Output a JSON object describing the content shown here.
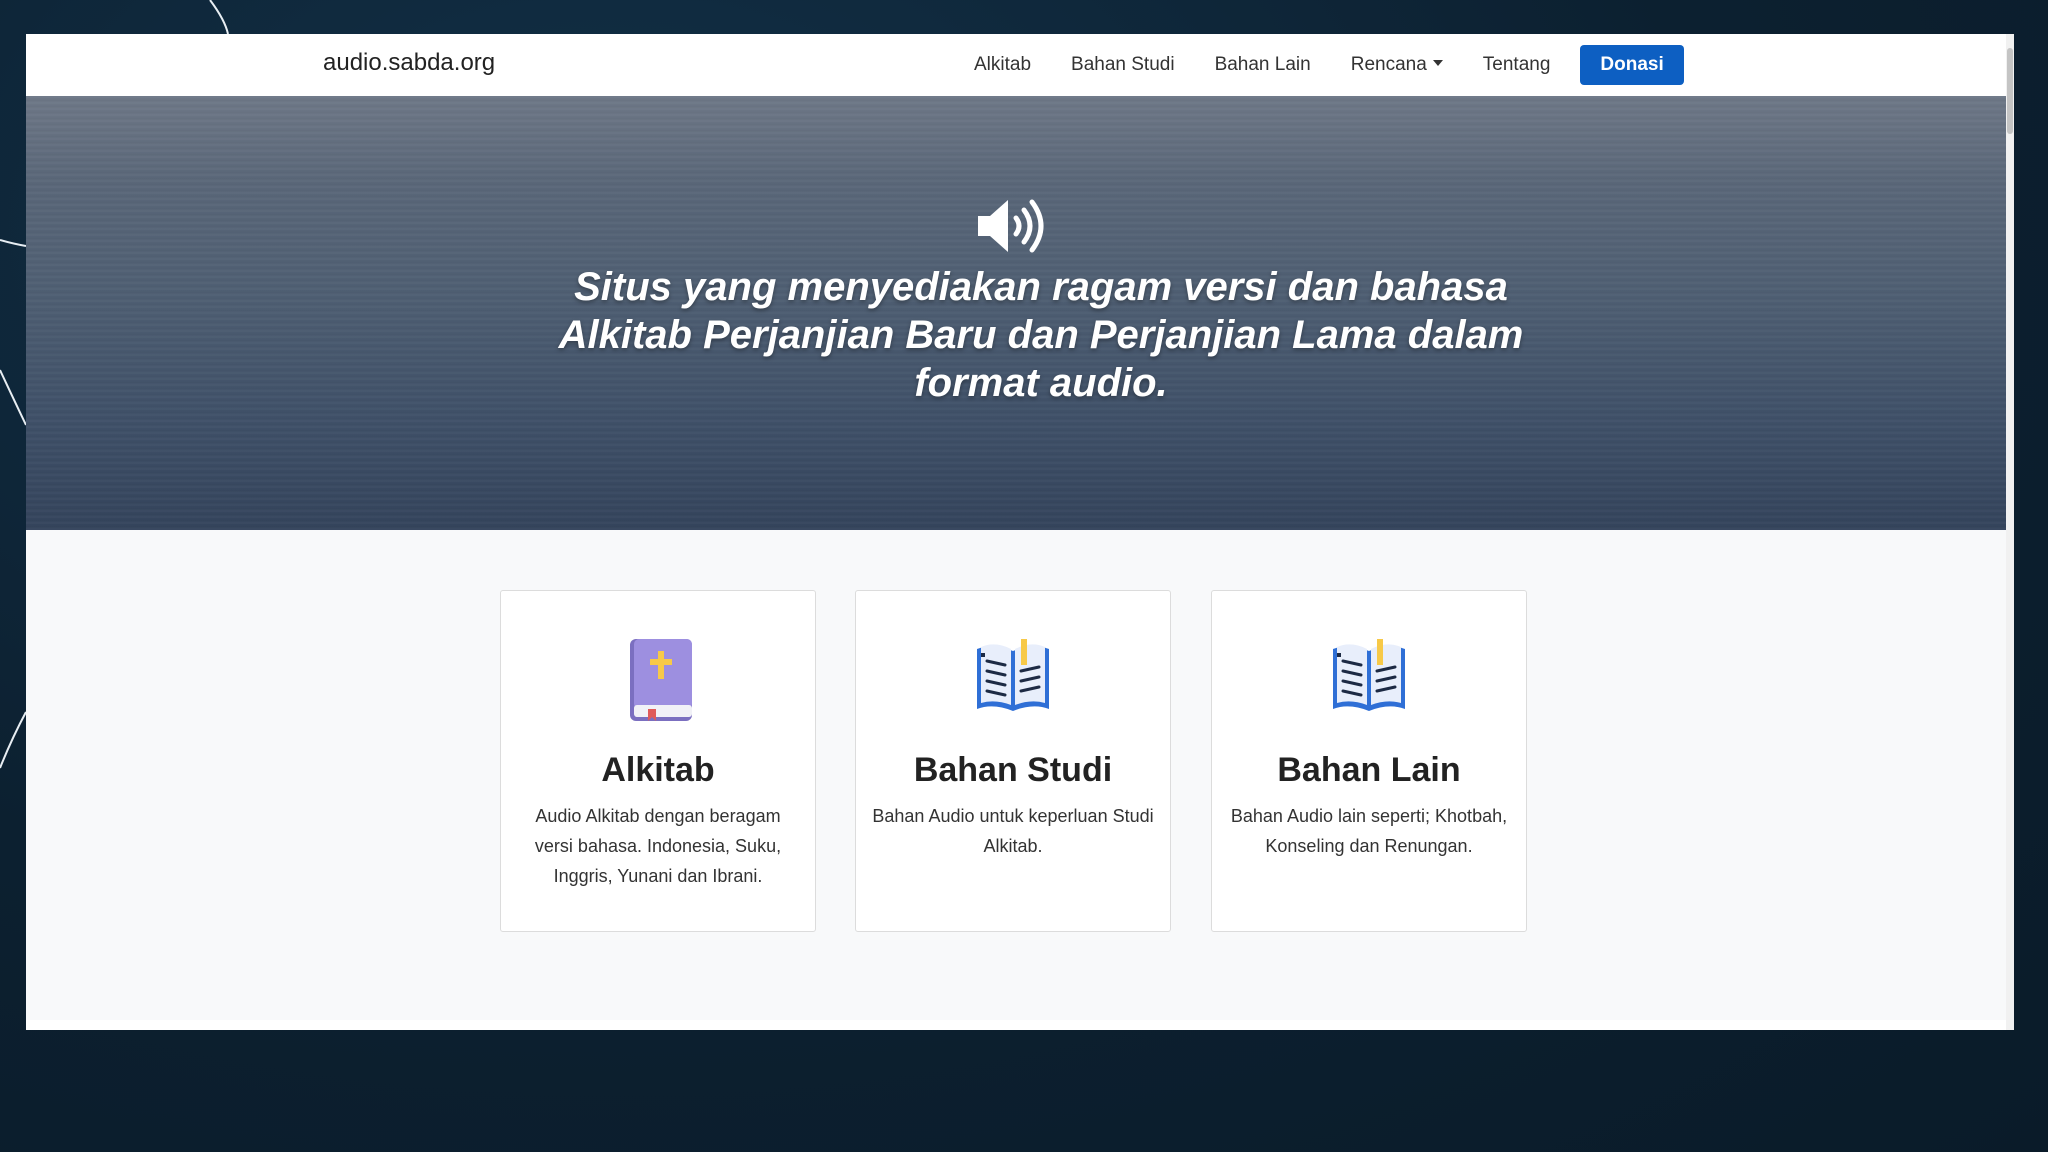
{
  "navbar": {
    "brand": "audio.sabda.org",
    "links": [
      "Alkitab",
      "Bahan Studi",
      "Bahan Lain",
      "Rencana",
      "Tentang"
    ],
    "donate": "Donasi"
  },
  "hero": {
    "icon": "speaker-icon",
    "text": "Situs yang menyediakan ragam versi dan bahasa Alkitab Perjanjian Baru dan Perjanjian Lama dalam format audio."
  },
  "cards": [
    {
      "icon": "bible-icon",
      "title": "Alkitab",
      "text": "Audio Alkitab dengan beragam versi bahasa. Indonesia, Suku, Inggris, Yunani dan Ibrani."
    },
    {
      "icon": "open-book-icon",
      "title": "Bahan Studi",
      "text": "Bahan Audio untuk keperluan Studi Alkitab."
    },
    {
      "icon": "open-book-icon",
      "title": "Bahan Lain",
      "text": "Bahan Audio lain seperti; Khotbah, Konseling dan Renungan."
    }
  ],
  "colors": {
    "accent": "#0d5fc2",
    "backdrop": "#0d2233"
  }
}
